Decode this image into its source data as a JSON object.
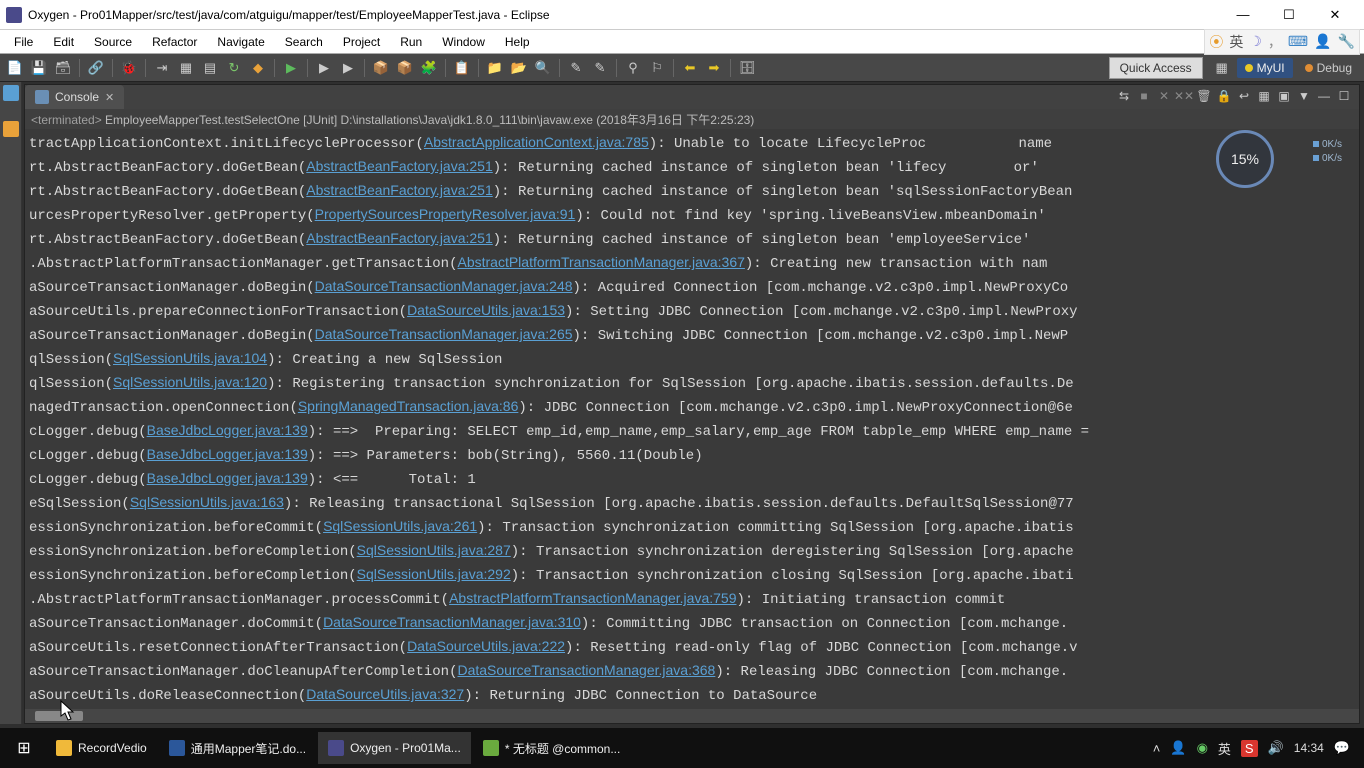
{
  "title": "Oxygen - Pro01Mapper/src/test/java/com/atguigu/mapper/test/EmployeeMapperTest.java - Eclipse",
  "menus": [
    "File",
    "Edit",
    "Source",
    "Refactor",
    "Navigate",
    "Search",
    "Project",
    "Run",
    "Window",
    "Help"
  ],
  "ime_box": {
    "lang": "英"
  },
  "quick_access": "Quick Access",
  "perspectives": {
    "myui": "MyUI",
    "debug": "Debug"
  },
  "console_tab": "Console",
  "console_header": {
    "terminated": "<terminated>",
    "rest": " EmployeeMapperTest.testSelectOne [JUnit] D:\\installations\\Java\\jdk1.8.0_111\\bin\\javaw.exe (2018年3月16日 下午2:25:23)"
  },
  "overlay": {
    "pct": "15%",
    "up": "0K/s",
    "down": "0K/s"
  },
  "lines": [
    {
      "pre": "tractApplicationContext.initLifecycleProcessor(",
      "link": "AbstractApplicationContext.java:785",
      "post": "): Unable to locate LifecycleProc           name"
    },
    {
      "pre": "rt.AbstractBeanFactory.doGetBean(",
      "link": "AbstractBeanFactory.java:251",
      "post": "): Returning cached instance of singleton bean 'lifecy        or'"
    },
    {
      "pre": "rt.AbstractBeanFactory.doGetBean(",
      "link": "AbstractBeanFactory.java:251",
      "post": "): Returning cached instance of singleton bean 'sqlSessionFactoryBean"
    },
    {
      "pre": "urcesPropertyResolver.getProperty(",
      "link": "PropertySourcesPropertyResolver.java:91",
      "post": "): Could not find key 'spring.liveBeansView.mbeanDomain'"
    },
    {
      "pre": "rt.AbstractBeanFactory.doGetBean(",
      "link": "AbstractBeanFactory.java:251",
      "post": "): Returning cached instance of singleton bean 'employeeService'"
    },
    {
      "pre": ".AbstractPlatformTransactionManager.getTransaction(",
      "link": "AbstractPlatformTransactionManager.java:367",
      "post": "): Creating new transaction with nam"
    },
    {
      "pre": "aSourceTransactionManager.doBegin(",
      "link": "DataSourceTransactionManager.java:248",
      "post": "): Acquired Connection [com.mchange.v2.c3p0.impl.NewProxyCo"
    },
    {
      "pre": "aSourceUtils.prepareConnectionForTransaction(",
      "link": "DataSourceUtils.java:153",
      "post": "): Setting JDBC Connection [com.mchange.v2.c3p0.impl.NewProxy"
    },
    {
      "pre": "aSourceTransactionManager.doBegin(",
      "link": "DataSourceTransactionManager.java:265",
      "post": "): Switching JDBC Connection [com.mchange.v2.c3p0.impl.NewP"
    },
    {
      "pre": "qlSession(",
      "link": "SqlSessionUtils.java:104",
      "post": "): Creating a new SqlSession"
    },
    {
      "pre": "qlSession(",
      "link": "SqlSessionUtils.java:120",
      "post": "): Registering transaction synchronization for SqlSession [org.apache.ibatis.session.defaults.De"
    },
    {
      "pre": "nagedTransaction.openConnection(",
      "link": "SpringManagedTransaction.java:86",
      "post": "): JDBC Connection [com.mchange.v2.c3p0.impl.NewProxyConnection@6e"
    },
    {
      "pre": "cLogger.debug(",
      "link": "BaseJdbcLogger.java:139",
      "post": "): ==>  Preparing: SELECT emp_id,emp_name,emp_salary,emp_age FROM tabple_emp WHERE emp_name = "
    },
    {
      "pre": "cLogger.debug(",
      "link": "BaseJdbcLogger.java:139",
      "post": "): ==> Parameters: bob(String), 5560.11(Double)"
    },
    {
      "pre": "cLogger.debug(",
      "link": "BaseJdbcLogger.java:139",
      "post": "): <==      Total: 1"
    },
    {
      "pre": "eSqlSession(",
      "link": "SqlSessionUtils.java:163",
      "post": "): Releasing transactional SqlSession [org.apache.ibatis.session.defaults.DefaultSqlSession@77"
    },
    {
      "pre": "essionSynchronization.beforeCommit(",
      "link": "SqlSessionUtils.java:261",
      "post": "): Transaction synchronization committing SqlSession [org.apache.ibatis"
    },
    {
      "pre": "essionSynchronization.beforeCompletion(",
      "link": "SqlSessionUtils.java:287",
      "post": "): Transaction synchronization deregistering SqlSession [org.apache"
    },
    {
      "pre": "essionSynchronization.beforeCompletion(",
      "link": "SqlSessionUtils.java:292",
      "post": "): Transaction synchronization closing SqlSession [org.apache.ibati"
    },
    {
      "pre": ".AbstractPlatformTransactionManager.processCommit(",
      "link": "AbstractPlatformTransactionManager.java:759",
      "post": "): Initiating transaction commit"
    },
    {
      "pre": "aSourceTransactionManager.doCommit(",
      "link": "DataSourceTransactionManager.java:310",
      "post": "): Committing JDBC transaction on Connection [com.mchange."
    },
    {
      "pre": "aSourceUtils.resetConnectionAfterTransaction(",
      "link": "DataSourceUtils.java:222",
      "post": "): Resetting read-only flag of JDBC Connection [com.mchange.v"
    },
    {
      "pre": "aSourceTransactionManager.doCleanupAfterCompletion(",
      "link": "DataSourceTransactionManager.java:368",
      "post": "): Releasing JDBC Connection [com.mchange."
    },
    {
      "pre": "aSourceUtils.doReleaseConnection(",
      "link": "DataSourceUtils.java:327",
      "post": "): Returning JDBC Connection to DataSource"
    }
  ],
  "taskbar": {
    "items": [
      {
        "label": "RecordVedio",
        "color": "#f0b93a"
      },
      {
        "label": "通用Mapper笔记.do...",
        "color": "#2b579a"
      },
      {
        "label": "Oxygen - Pro01Ma...",
        "color": "#4a4a8a"
      },
      {
        "label": "* 无标题 @common...",
        "color": "#6aaa3e"
      }
    ],
    "tray": {
      "lang": "英",
      "ime": "S",
      "time": "14:34"
    }
  }
}
